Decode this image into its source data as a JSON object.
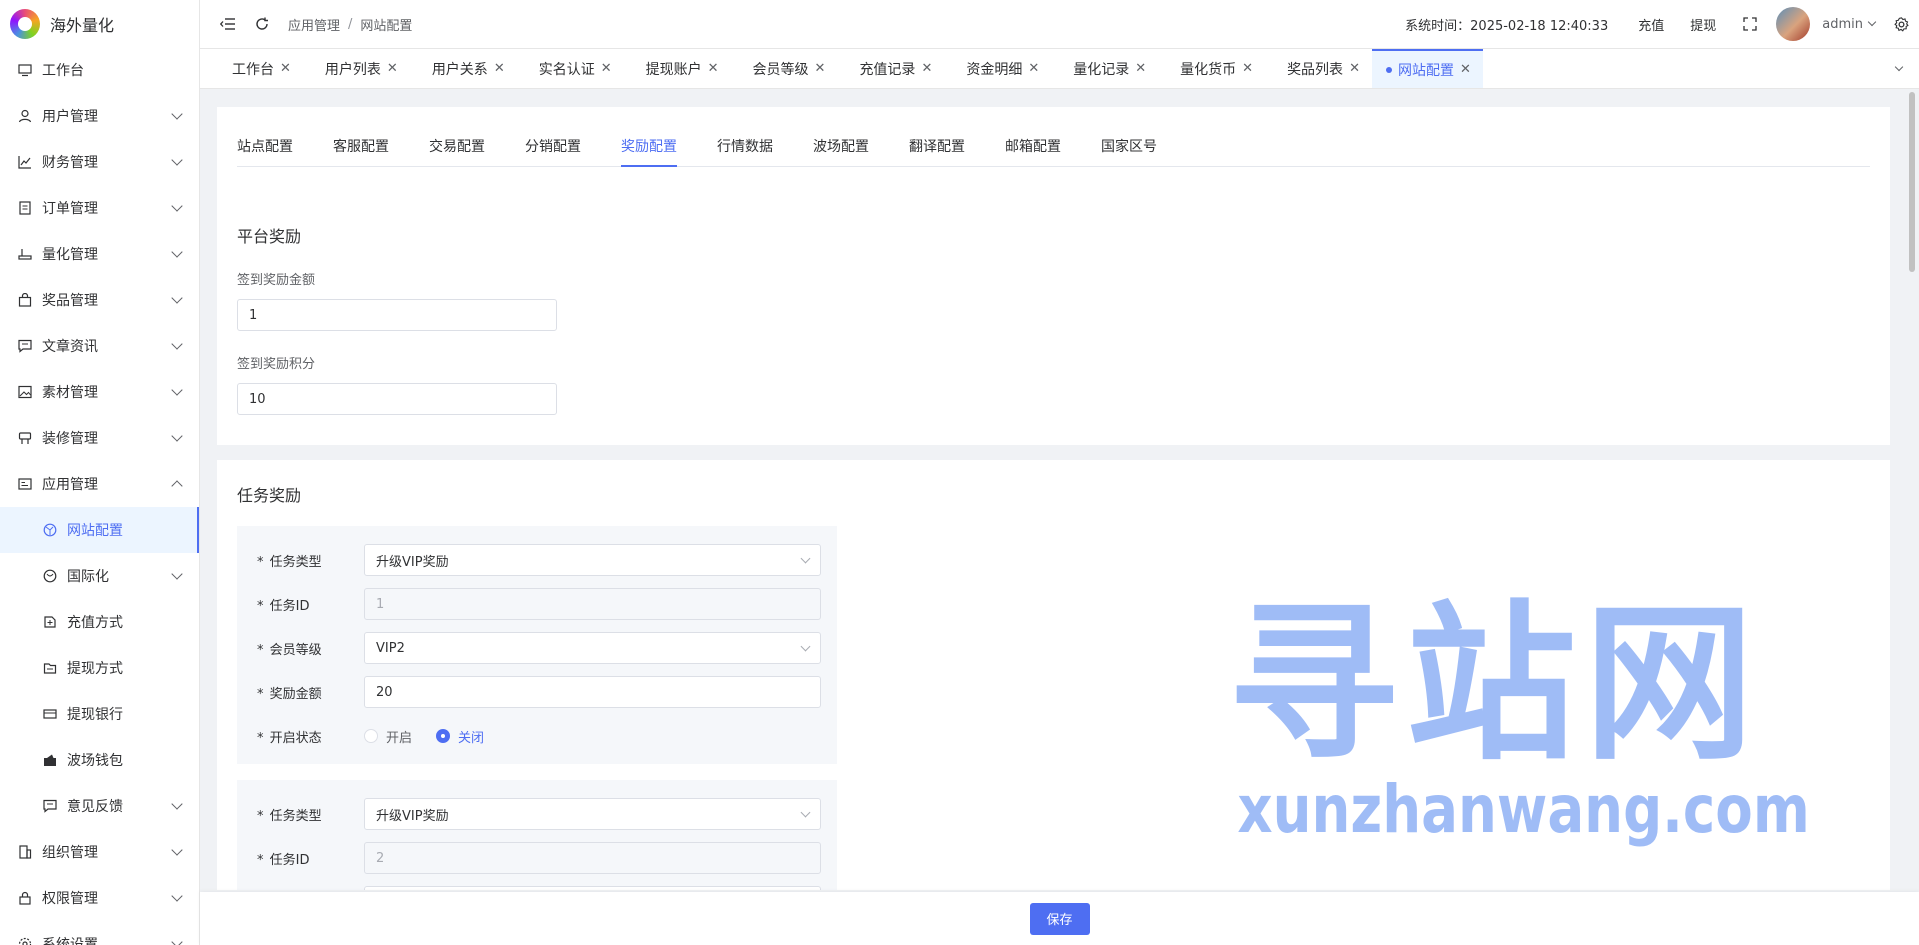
{
  "app": {
    "logo_text": "海外量化"
  },
  "sidebar": {
    "items": [
      {
        "label": "工作台",
        "icon": "monitor-icon",
        "chevron": ""
      },
      {
        "label": "用户管理",
        "icon": "user-icon",
        "chevron": "down"
      },
      {
        "label": "财务管理",
        "icon": "chart-icon",
        "chevron": "down"
      },
      {
        "label": "订单管理",
        "icon": "document-icon",
        "chevron": "down"
      },
      {
        "label": "量化管理",
        "icon": "equalizer-icon",
        "chevron": "down"
      },
      {
        "label": "奖品管理",
        "icon": "bag-icon",
        "chevron": "down"
      },
      {
        "label": "文章资讯",
        "icon": "message-icon",
        "chevron": "down"
      },
      {
        "label": "素材管理",
        "icon": "picture-icon",
        "chevron": "down"
      },
      {
        "label": "装修管理",
        "icon": "brush-icon",
        "chevron": "down"
      },
      {
        "label": "应用管理",
        "icon": "app-icon",
        "chevron": "up"
      }
    ],
    "sub_items": [
      {
        "label": "网站配置",
        "icon": "globe-icon",
        "chevron": "",
        "active": true
      },
      {
        "label": "国际化",
        "icon": "i18n-icon",
        "chevron": "down"
      },
      {
        "label": "充值方式",
        "icon": "recharge-icon",
        "chevron": ""
      },
      {
        "label": "提现方式",
        "icon": "withdraw-icon",
        "chevron": ""
      },
      {
        "label": "提现银行",
        "icon": "card-icon",
        "chevron": ""
      },
      {
        "label": "波场钱包",
        "icon": "wallet-icon",
        "chevron": ""
      },
      {
        "label": "意见反馈",
        "icon": "feedback-icon",
        "chevron": "down"
      }
    ],
    "bottom_items": [
      {
        "label": "组织管理",
        "icon": "office-icon",
        "chevron": "down"
      },
      {
        "label": "权限管理",
        "icon": "lock-icon",
        "chevron": "down"
      },
      {
        "label": "系统设置",
        "icon": "setting-icon",
        "chevron": "down"
      }
    ]
  },
  "header": {
    "breadcrumb": [
      "应用管理",
      "网站配置"
    ],
    "system_time": "系统时间：2025-02-18 12:40:33",
    "recharge_link": "充值",
    "withdraw_link": "提现",
    "username": "admin"
  },
  "tabs": [
    "工作台",
    "用户列表",
    "用户关系",
    "实名认证",
    "提现账户",
    "会员等级",
    "充值记录",
    "资金明细",
    "量化记录",
    "量化货币",
    "奖品列表",
    "网站配置"
  ],
  "active_tab": "网站配置",
  "sub_tabs": [
    "站点配置",
    "客服配置",
    "交易配置",
    "分销配置",
    "奖励配置",
    "行情数据",
    "波场配置",
    "翻译配置",
    "邮箱配置",
    "国家区号"
  ],
  "active_sub_tab": "奖励配置",
  "platform_reward": {
    "title": "平台奖励",
    "signin_amount_label": "签到奖励金额",
    "signin_amount_value": "1",
    "signin_points_label": "签到奖励积分",
    "signin_points_value": "10"
  },
  "task_reward": {
    "title": "任务奖励",
    "labels": {
      "type": "任务类型",
      "id": "任务ID",
      "level": "会员等级",
      "amount": "奖励金额",
      "status": "开启状态",
      "open": "开启",
      "close": "关闭"
    },
    "tasks": [
      {
        "type": "升级VIP奖励",
        "id": "1",
        "level": "VIP2",
        "amount": "20",
        "status": "关闭"
      },
      {
        "type": "升级VIP奖励",
        "id": "2"
      }
    ]
  },
  "watermark": {
    "cn": "寻站网",
    "en": "xunzhanwang.com"
  },
  "footer": {
    "save_label": "保存"
  },
  "colors": {
    "accent": "#4e6ef2",
    "active_bg": "#ecf5ff",
    "watermark": "#6a96f0"
  }
}
